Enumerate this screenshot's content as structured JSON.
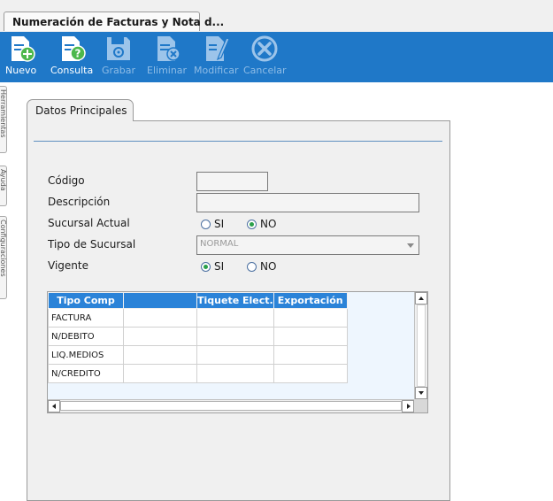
{
  "document_tab": {
    "title": "Numeración de Facturas y Nota d...",
    "icon": "app-icon"
  },
  "toolbar": {
    "nuevo": {
      "label": "Nuevo",
      "icon": "new-document-icon",
      "enabled": true
    },
    "consulta": {
      "label": "Consulta",
      "icon": "query-document-icon",
      "enabled": true
    },
    "grabar": {
      "label": "Grabar",
      "icon": "save-disk-icon",
      "enabled": false
    },
    "eliminar": {
      "label": "Eliminar",
      "icon": "delete-document-icon",
      "enabled": false
    },
    "modificar": {
      "label": "Modificar",
      "icon": "edit-document-icon",
      "enabled": false
    },
    "cancelar": {
      "label": "Cancelar",
      "icon": "cancel-icon",
      "enabled": false
    }
  },
  "side_tabs": [
    "Herramientas",
    "Ayuda",
    "Configuraciones"
  ],
  "panel": {
    "tab_label": "Datos Principales"
  },
  "form": {
    "codigo": {
      "label": "Código",
      "value": ""
    },
    "descripcion": {
      "label": "Descripción",
      "value": ""
    },
    "sucursal_actual": {
      "label": "Sucursal Actual",
      "option_si": "SI",
      "option_no": "NO",
      "selected": "NO"
    },
    "tipo_sucursal": {
      "label": "Tipo de Sucursal",
      "value": "NORMAL"
    },
    "vigente": {
      "label": "Vigente",
      "option_si": "SI",
      "option_no": "NO",
      "selected": "SI"
    }
  },
  "grid": {
    "columns": [
      "Tipo Comp",
      "",
      "Tiquete Elect.",
      "Exportación"
    ],
    "rows": [
      [
        "FACTURA",
        "",
        "",
        ""
      ],
      [
        "N/DEBITO",
        "",
        "",
        ""
      ],
      [
        "LIQ.MEDIOS",
        "",
        "",
        ""
      ],
      [
        "N/CREDITO",
        "",
        "",
        ""
      ]
    ]
  },
  "colors": {
    "toolbar_bg": "#1f78c8",
    "grid_header_bg": "#2b83d8",
    "radio_selected": "#2aa04a"
  }
}
